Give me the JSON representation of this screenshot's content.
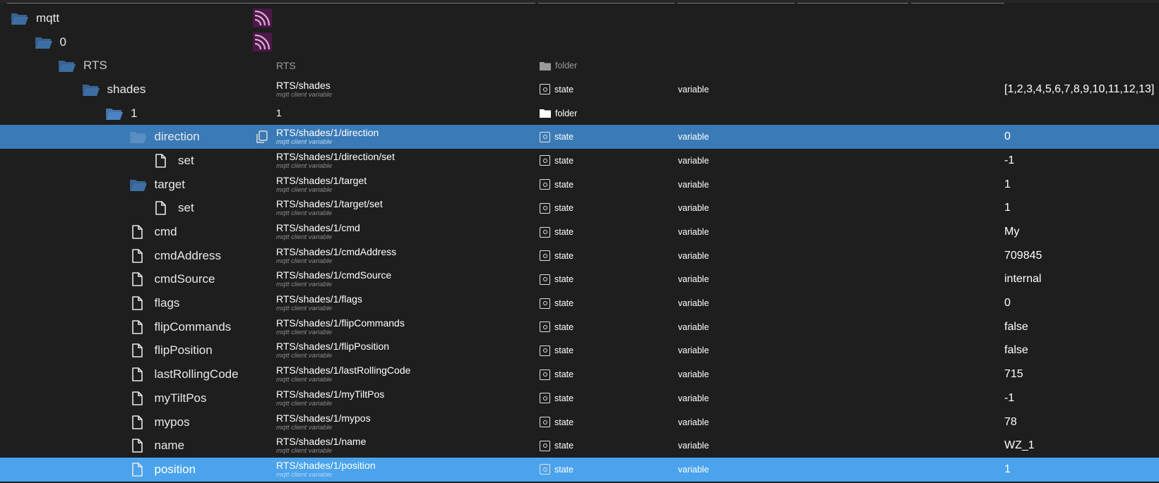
{
  "rows": [
    {
      "label": "mqtt",
      "kind": "folder",
      "indent": 0,
      "logo": true,
      "path": "",
      "sub": "",
      "ctype": "",
      "role": "",
      "value": ""
    },
    {
      "label": "0",
      "kind": "folder",
      "indent": 1,
      "logo": true,
      "path": "",
      "sub": "",
      "ctype": "",
      "role": "",
      "value": ""
    },
    {
      "label": "RTS",
      "kind": "folder",
      "indent": 2,
      "logo": false,
      "path": "RTS",
      "sub": "",
      "ctype": "folder",
      "role": "",
      "value": "",
      "dim": true
    },
    {
      "label": "shades",
      "kind": "folder",
      "indent": 3,
      "logo": false,
      "path": "RTS/shades",
      "sub": "mqtt client variable",
      "ctype": "state",
      "role": "variable",
      "value": "[1,2,3,4,5,6,7,8,9,10,11,12,13]"
    },
    {
      "label": "1",
      "kind": "folder",
      "indent": 4,
      "logo": false,
      "path": "1",
      "sub": "",
      "ctype": "folder",
      "role": "",
      "value": "",
      "whiteFolder": true
    },
    {
      "label": "direction",
      "kind": "folder",
      "indent": 5,
      "logo": false,
      "path": "RTS/shades/1/direction",
      "sub": "mqtt client variable",
      "ctype": "state",
      "role": "variable",
      "value": "0",
      "selected": "dark"
    },
    {
      "label": "set",
      "kind": "file",
      "indent": 6,
      "logo": false,
      "path": "RTS/shades/1/direction/set",
      "sub": "mqtt client variable",
      "ctype": "state",
      "role": "variable",
      "value": "-1"
    },
    {
      "label": "target",
      "kind": "folder",
      "indent": 5,
      "logo": false,
      "path": "RTS/shades/1/target",
      "sub": "mqtt client variable",
      "ctype": "state",
      "role": "variable",
      "value": "1"
    },
    {
      "label": "set",
      "kind": "file",
      "indent": 6,
      "logo": false,
      "path": "RTS/shades/1/target/set",
      "sub": "mqtt client variable",
      "ctype": "state",
      "role": "variable",
      "value": "1"
    },
    {
      "label": "cmd",
      "kind": "file",
      "indent": 5,
      "logo": false,
      "path": "RTS/shades/1/cmd",
      "sub": "mqtt client variable",
      "ctype": "state",
      "role": "variable",
      "value": "My"
    },
    {
      "label": "cmdAddress",
      "kind": "file",
      "indent": 5,
      "logo": false,
      "path": "RTS/shades/1/cmdAddress",
      "sub": "mqtt client variable",
      "ctype": "state",
      "role": "variable",
      "value": "709845"
    },
    {
      "label": "cmdSource",
      "kind": "file",
      "indent": 5,
      "logo": false,
      "path": "RTS/shades/1/cmdSource",
      "sub": "mqtt client variable",
      "ctype": "state",
      "role": "variable",
      "value": "internal"
    },
    {
      "label": "flags",
      "kind": "file",
      "indent": 5,
      "logo": false,
      "path": "RTS/shades/1/flags",
      "sub": "mqtt client variable",
      "ctype": "state",
      "role": "variable",
      "value": "0"
    },
    {
      "label": "flipCommands",
      "kind": "file",
      "indent": 5,
      "logo": false,
      "path": "RTS/shades/1/flipCommands",
      "sub": "mqtt client variable",
      "ctype": "state",
      "role": "variable",
      "value": "false"
    },
    {
      "label": "flipPosition",
      "kind": "file",
      "indent": 5,
      "logo": false,
      "path": "RTS/shades/1/flipPosition",
      "sub": "mqtt client variable",
      "ctype": "state",
      "role": "variable",
      "value": "false"
    },
    {
      "label": "lastRollingCode",
      "kind": "file",
      "indent": 5,
      "logo": false,
      "path": "RTS/shades/1/lastRollingCode",
      "sub": "mqtt client variable",
      "ctype": "state",
      "role": "variable",
      "value": "715"
    },
    {
      "label": "myTiltPos",
      "kind": "file",
      "indent": 5,
      "logo": false,
      "path": "RTS/shades/1/myTiltPos",
      "sub": "mqtt client variable",
      "ctype": "state",
      "role": "variable",
      "value": "-1"
    },
    {
      "label": "mypos",
      "kind": "file",
      "indent": 5,
      "logo": false,
      "path": "RTS/shades/1/mypos",
      "sub": "mqtt client variable",
      "ctype": "state",
      "role": "variable",
      "value": "78"
    },
    {
      "label": "name",
      "kind": "file",
      "indent": 5,
      "logo": false,
      "path": "RTS/shades/1/name",
      "sub": "mqtt client variable",
      "ctype": "state",
      "role": "variable",
      "value": "WZ_1"
    },
    {
      "label": "position",
      "kind": "file",
      "indent": 5,
      "logo": false,
      "path": "RTS/shades/1/position",
      "sub": "mqtt client variable",
      "ctype": "state",
      "role": "variable",
      "value": "1",
      "selected": "light"
    }
  ],
  "colors": {
    "folder": "#3d6fa3",
    "selected": "#3a7ab6",
    "selected_light": "#4aa3ec",
    "logo_bg": "#4b1848"
  }
}
